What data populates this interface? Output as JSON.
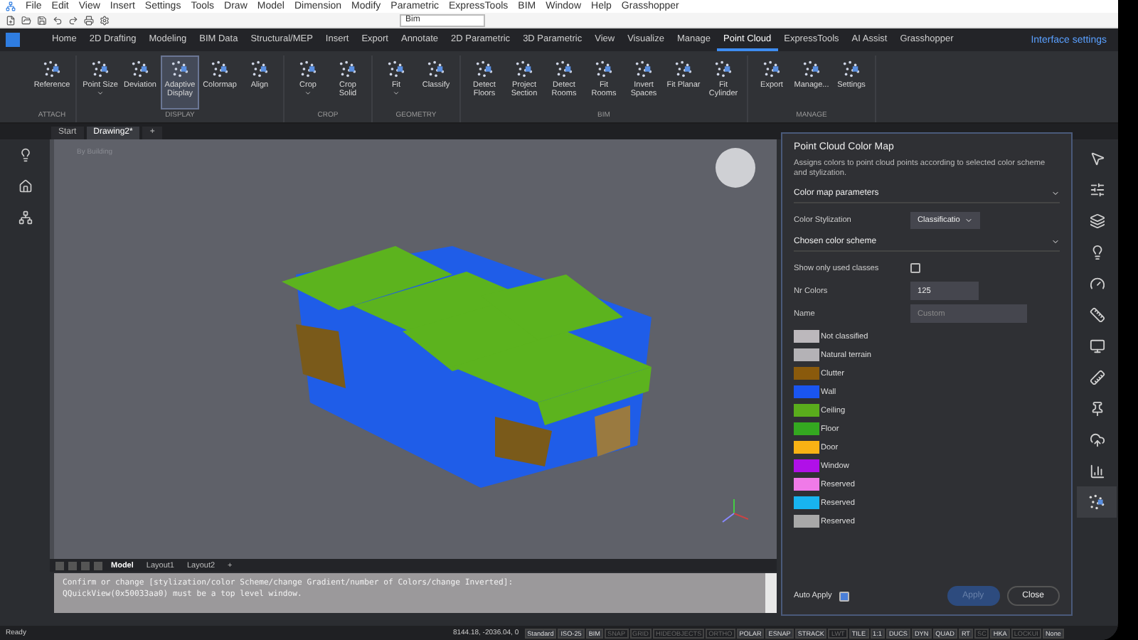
{
  "menu_bar": {
    "items": [
      "File",
      "Edit",
      "View",
      "Insert",
      "Settings",
      "Tools",
      "Draw",
      "Model",
      "Dimension",
      "Modify",
      "Parametric",
      "ExpressTools",
      "BIM",
      "Window",
      "Help",
      "Grasshopper"
    ]
  },
  "quick_access": {
    "workspace": "Bim"
  },
  "ribbon": {
    "tabs": [
      {
        "label": "Home",
        "selected": false
      },
      {
        "label": "2D Drafting",
        "selected": false
      },
      {
        "label": "Modeling",
        "selected": false
      },
      {
        "label": "BIM Data",
        "selected": false
      },
      {
        "label": "Structural/MEP",
        "selected": false
      },
      {
        "label": "Insert",
        "selected": false
      },
      {
        "label": "Export",
        "selected": false
      },
      {
        "label": "Annotate",
        "selected": false
      },
      {
        "label": "2D Parametric",
        "selected": false
      },
      {
        "label": "3D Parametric",
        "selected": false
      },
      {
        "label": "View",
        "selected": false
      },
      {
        "label": "Visualize",
        "selected": false
      },
      {
        "label": "Manage",
        "selected": false
      },
      {
        "label": "Point Cloud",
        "selected": true
      },
      {
        "label": "ExpressTools",
        "selected": false
      },
      {
        "label": "AI Assist",
        "selected": false
      },
      {
        "label": "Grasshopper",
        "selected": false
      }
    ],
    "interface_settings": "Interface settings",
    "groups": [
      {
        "title": "ATTACH",
        "buttons": [
          {
            "label": "Reference",
            "selected": false,
            "dropdown": false
          }
        ]
      },
      {
        "title": "DISPLAY",
        "buttons": [
          {
            "label": "Point Size",
            "selected": false,
            "dropdown": true
          },
          {
            "label": "Deviation",
            "selected": false,
            "dropdown": false
          },
          {
            "label": "Adaptive Display",
            "selected": true,
            "dropdown": false
          },
          {
            "label": "Colormap",
            "selected": false,
            "dropdown": false
          },
          {
            "label": "Align",
            "selected": false,
            "dropdown": false
          }
        ]
      },
      {
        "title": "CROP",
        "buttons": [
          {
            "label": "Crop",
            "selected": false,
            "dropdown": true
          },
          {
            "label": "Crop Solid",
            "selected": false,
            "dropdown": false
          }
        ]
      },
      {
        "title": "GEOMETRY",
        "buttons": [
          {
            "label": "Fit",
            "selected": false,
            "dropdown": true
          },
          {
            "label": "Classify",
            "selected": false,
            "dropdown": false
          }
        ]
      },
      {
        "title": "BIM",
        "buttons": [
          {
            "label": "Detect Floors",
            "selected": false,
            "dropdown": false
          },
          {
            "label": "Project Section",
            "selected": false,
            "dropdown": false
          },
          {
            "label": "Detect Rooms",
            "selected": false,
            "dropdown": false
          },
          {
            "label": "Fit Rooms",
            "selected": false,
            "dropdown": false
          },
          {
            "label": "Invert Spaces",
            "selected": false,
            "dropdown": false
          },
          {
            "label": "Fit Planar",
            "selected": false,
            "dropdown": false
          },
          {
            "label": "Fit Cylinder",
            "selected": false,
            "dropdown": false
          }
        ]
      },
      {
        "title": "MANAGE",
        "buttons": [
          {
            "label": "Export",
            "selected": false,
            "dropdown": false
          },
          {
            "label": "Manage...",
            "selected": false,
            "dropdown": false
          },
          {
            "label": "Settings",
            "selected": false,
            "dropdown": false
          }
        ]
      }
    ]
  },
  "document_tabs": [
    {
      "label": "Start",
      "selected": false
    },
    {
      "label": "Drawing2*",
      "selected": true
    }
  ],
  "new_tab": "+",
  "viewport": {
    "view_label": "By Building"
  },
  "layout_tabs": [
    {
      "label": "Model",
      "selected": true
    },
    {
      "label": "Layout1",
      "selected": false
    },
    {
      "label": "Layout2",
      "selected": false
    }
  ],
  "new_layout": "+",
  "command_line": {
    "lines": [
      "Confirm or change [stylization/color Scheme/change Gradient/number of Colors/change Inverted]:",
      "QQuickView(0x50033aa0) must be a top level window."
    ]
  },
  "color_map_panel": {
    "title": "Point Cloud Color Map",
    "description": "Assigns colors to point cloud points according to selected color scheme and stylization.",
    "sections": [
      {
        "title": "Color map parameters",
        "expanded": true
      },
      {
        "title": "Chosen color scheme",
        "expanded": true
      }
    ],
    "stylization_label": "Color Stylization",
    "stylization_value": "Classificatio",
    "show_used_label": "Show only used classes",
    "show_used_checked": false,
    "nr_colors_label": "Nr Colors",
    "nr_colors_value": "125",
    "name_label": "Name",
    "name_placeholder": "Custom",
    "classes": [
      {
        "name": "Not classified",
        "color": "#bcb8bc"
      },
      {
        "name": "Natural terrain",
        "color": "#b4b2b6"
      },
      {
        "name": "Clutter",
        "color": "#8a5a0c"
      },
      {
        "name": "Wall",
        "color": "#1a55f0"
      },
      {
        "name": "Ceiling",
        "color": "#5aac1c"
      },
      {
        "name": "Floor",
        "color": "#34a820"
      },
      {
        "name": "Door",
        "color": "#f8b214"
      },
      {
        "name": "Window",
        "color": "#b010e8"
      },
      {
        "name": "Reserved",
        "color": "#f07ae8"
      },
      {
        "name": "Reserved",
        "color": "#18b4f0"
      },
      {
        "name": "Reserved",
        "color": "#a8a8a8"
      }
    ],
    "auto_apply_label": "Auto Apply",
    "auto_apply_checked": true,
    "apply": {
      "label": "Apply",
      "disabled": true
    },
    "close": {
      "label": "Close",
      "disabled": false
    }
  },
  "right_toolbar": [
    {
      "kind": "cursor",
      "selected": false
    },
    {
      "kind": "sliders",
      "selected": false
    },
    {
      "kind": "layers",
      "selected": false
    },
    {
      "kind": "bulb",
      "selected": false
    },
    {
      "kind": "gauge",
      "selected": false
    },
    {
      "kind": "ruler",
      "selected": false
    },
    {
      "kind": "display",
      "selected": false
    },
    {
      "kind": "beam",
      "selected": false
    },
    {
      "kind": "pin",
      "selected": false
    },
    {
      "kind": "cloud",
      "selected": false
    },
    {
      "kind": "chart",
      "selected": false
    },
    {
      "kind": "points",
      "selected": true
    }
  ],
  "status_bar": {
    "status": "Ready",
    "coordinates": "8144.18, -2036.04, 0",
    "toggles": [
      {
        "label": "Standard",
        "on": true
      },
      {
        "label": "ISO-25",
        "on": true
      },
      {
        "label": "BIM",
        "on": true
      },
      {
        "label": "SNAP",
        "on": false
      },
      {
        "label": "GRID",
        "on": false
      },
      {
        "label": "HIDEOBJECTS",
        "on": false
      },
      {
        "label": "ORTHO",
        "on": false
      },
      {
        "label": "POLAR",
        "on": true
      },
      {
        "label": "ESNAP",
        "on": true
      },
      {
        "label": "STRACK",
        "on": true
      },
      {
        "label": "LWT",
        "on": false
      },
      {
        "label": "TILE",
        "on": true
      },
      {
        "label": "1:1",
        "on": true
      },
      {
        "label": "DUCS",
        "on": true
      },
      {
        "label": "DYN",
        "on": true
      },
      {
        "label": "QUAD",
        "on": true
      },
      {
        "label": "RT",
        "on": true
      },
      {
        "label": "SC",
        "on": false
      },
      {
        "label": "HKA",
        "on": true
      },
      {
        "label": "LOCKUI",
        "on": false
      },
      {
        "label": "None",
        "on": true
      }
    ]
  }
}
